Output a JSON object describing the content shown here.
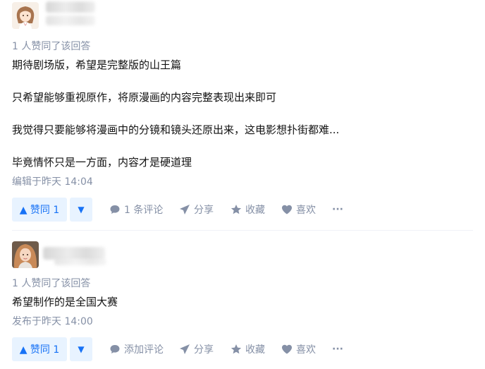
{
  "answers": [
    {
      "voters": "1 人赞同了该回答",
      "paragraphs": [
        "期待剧场版，希望是完整版的山王篇",
        "只希望能够重视原作，将原漫画的内容完整表现出来即可",
        "我觉得只要能够将漫画中的分镜和镜头还原出来，这电影想扑街都难...",
        "毕竟情怀只是一方面，内容才是硬道理"
      ],
      "time": "编辑于昨天 14:04",
      "vote_label": "▲ 赞同 1",
      "comment_label": "1 条评论",
      "share_label": "分享",
      "collect_label": "收藏",
      "like_label": "喜欢"
    },
    {
      "voters": "1 人赞同了该回答",
      "paragraphs": [
        "希望制作的是全国大赛"
      ],
      "time": "发布于昨天 14:00",
      "vote_label": "▲ 赞同 1",
      "comment_label": "添加评论",
      "share_label": "分享",
      "collect_label": "收藏",
      "like_label": "喜欢"
    }
  ],
  "colors": {
    "accent": "#1772f6",
    "vote_bg": "#e8f3ff",
    "meta": "#8590a6"
  }
}
